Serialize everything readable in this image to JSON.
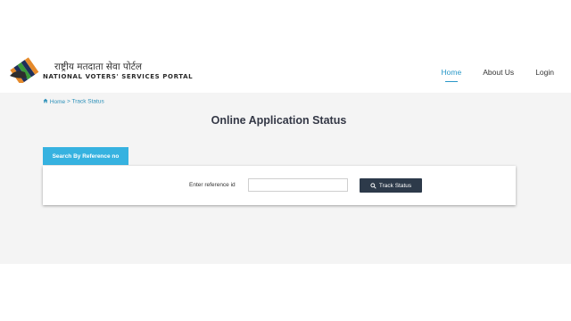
{
  "header": {
    "brand_hindi": "राष्ट्रीय मतदाता सेवा पोर्टल",
    "brand_english": "NATIONAL VOTERS' SERVICES PORTAL",
    "nav": [
      {
        "label": "Home"
      },
      {
        "label": "About Us"
      },
      {
        "label": "Login"
      }
    ],
    "active_nav": "Home"
  },
  "breadcrumb": {
    "home": "Home",
    "separator": ">",
    "current": "Track Status"
  },
  "page_title": "Online Application Status",
  "tab": {
    "label": "Search By Reference no"
  },
  "form": {
    "reference_label": "Enter reference id",
    "reference_value": "",
    "track_button": "Track Status"
  },
  "colors": {
    "accent": "#2a98c8",
    "tab_bg": "#36b2e0",
    "button_bg": "#2d3a4a",
    "content_bg": "#f4f4f4"
  }
}
